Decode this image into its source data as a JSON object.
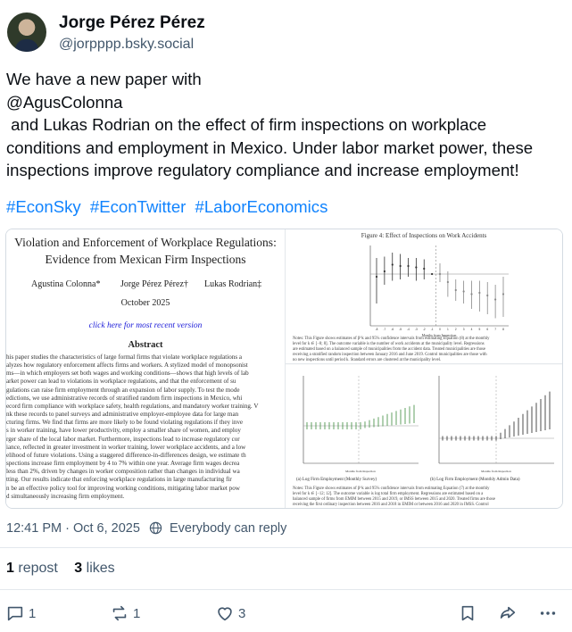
{
  "author": {
    "name": "Jorge Pérez Pérez",
    "handle": "@jorpppp.bsky.social"
  },
  "post": {
    "text": "We have a new paper with\n@AgusColonna\n and Lukas Rodrian on the effect of firm inspections on workplace conditions and employment in Mexico. Under labor market power, these inspections improve regulatory compliance and increase employment!",
    "hashtags": [
      "#EconSky",
      "#EconTwitter",
      "#LaborEconomics"
    ]
  },
  "embed": {
    "paper": {
      "title_line1": "Violation and Enforcement of Workplace Regulations:",
      "title_line2": "Evidence from Mexican Firm Inspections",
      "authors": [
        "Agustina Colonna*",
        "Jorge Pérez Pérez†",
        "Lukas Rodrian‡"
      ],
      "date": "October 2025",
      "link_text": "click here for most recent version",
      "abstract_heading": "Abstract",
      "abstract_lines": [
        "his paper studies the characteristics of large formal firms that violate workplace regulations a",
        "alyzes how regulatory enforcement affects firms and workers. A stylized model of monopsonist",
        "ms—in which employers set both wages and working conditions—shows that high levels of lab",
        "arket power can lead to violations in workplace regulations, and that the enforcement of su",
        "gulations can raise firm employment through an expansion of labor supply. To test the mode",
        "edictions, we use administrative records of stratified random firm inspections in Mexico, whi",
        "ecord firm compliance with workplace safety, health regulations, and mandatory worker training. V",
        "nk these records to panel surveys and administrative employer-employee data for large man",
        "cturing firms. We find that firms are more likely to be found violating regulations if they inve",
        "s in worker training, have lower productivity, employ a smaller share of women, and employ",
        "rger share of the local labor market. Furthermore, inspections lead to increase regulatory cor",
        "iance, reflected in greater investment in worker training, lower workplace accidents, and a low",
        "elihood of future violations. Using a staggered difference-in-differences design, we estimate th",
        "spections increase firm employment by 4 to 7% within one year. Average firm wages decrea",
        " less than 2%, driven by changes in worker composition rather than changes in individual wa",
        "tting. Our results indicate that enforcing workplace regulations in large manufacturing fir",
        "n be an effective policy tool for improving working conditions, mitigating labor market pow",
        "d simultaneously increasing firm employment."
      ]
    },
    "figures": {
      "top_title": "Figure 4: Effect of Inspections on Work Accidents",
      "top_note_lines": [
        "Notes: This Figure shows estimates of β^k and 95% confidence intervals from estimating Equation (8) at the monthly",
        "level for k ∈ [−8; 8]. The outcome variable is the number of work accidents at the municipality level. Regressions",
        "are estimated based on a balanced sample of municipalities from the accident data. Treated municipalities are those",
        "receiving a stratified random inspection between January 2016 and June 2019. Control municipalities are those with",
        "no new inspections until period k. Standard errors are clustered at the municipality level."
      ],
      "caption_a": "(a) Log Firm Employment (Monthly Survey)",
      "caption_b": "(b) Log Firm Employment (Monthly Admin Data)",
      "bottom_note_lines": [
        "Notes: This Figure shows estimates of β^k and 95% confidence intervals from estimating Equation (7) at the monthly",
        "level for k ∈ [−12; 12]. The outcome variable is log total firm employment. Regressions are estimated based on a",
        "balanced sample of firms from EMIM between 2015 and 2019, or IMSS between 2015 and 2020. Treated firms are those",
        "receiving the first ordinary inspection between 2016 and 2018 in EMIM or between 2016 and 2020 in IMSS. Control"
      ],
      "months_label": "Months from Inspection",
      "top_chart": {
        "x_ticks": [
          "-8",
          "-7",
          "-6",
          "-5",
          "-4",
          "-3",
          "-2",
          "-1",
          "0",
          "1",
          "2",
          "3",
          "4",
          "5",
          "6",
          "7",
          "8"
        ],
        "points": [
          {
            "k": -8,
            "est": -0.02,
            "lo": -0.22,
            "hi": 0.12
          },
          {
            "k": -7,
            "est": 0.02,
            "lo": -0.08,
            "hi": 0.13
          },
          {
            "k": -6,
            "est": 0.07,
            "lo": -0.05,
            "hi": 0.16
          },
          {
            "k": -5,
            "est": 0.06,
            "lo": -0.04,
            "hi": 0.15
          },
          {
            "k": -4,
            "est": 0.06,
            "lo": -0.02,
            "hi": 0.12
          },
          {
            "k": -3,
            "est": 0.05,
            "lo": -0.05,
            "hi": 0.12
          },
          {
            "k": -2,
            "est": 0.04,
            "lo": -0.04,
            "hi": 0.11
          },
          {
            "k": -1,
            "est": 0.0,
            "lo": 0.0,
            "hi": 0.0
          },
          {
            "k": 0,
            "est": 0.0,
            "lo": -0.06,
            "hi": 0.08
          },
          {
            "k": 1,
            "est": -0.06,
            "lo": -0.17,
            "hi": 0.02
          },
          {
            "k": 2,
            "est": -0.12,
            "lo": -0.2,
            "hi": -0.04
          },
          {
            "k": 3,
            "est": -0.13,
            "lo": -0.22,
            "hi": -0.05
          },
          {
            "k": 4,
            "est": -0.15,
            "lo": -0.26,
            "hi": -0.05
          },
          {
            "k": 5,
            "est": -0.14,
            "lo": -0.28,
            "hi": -0.05
          },
          {
            "k": 6,
            "est": -0.16,
            "lo": -0.3,
            "hi": -0.06
          },
          {
            "k": 7,
            "est": -0.19,
            "lo": -0.33,
            "hi": -0.08
          },
          {
            "k": 8,
            "est": -0.15,
            "lo": -0.32,
            "hi": -0.02
          }
        ]
      }
    }
  },
  "meta": {
    "timestamp": "12:41 PM · Oct 6, 2025",
    "reply_setting": "Everybody can reply"
  },
  "stats": {
    "reposts_count": "1",
    "reposts_label": "repost",
    "likes_count": "3",
    "likes_label": "likes"
  },
  "actions": {
    "reply_count": "1",
    "repost_count": "1",
    "like_count": "3"
  },
  "colors": {
    "link": "#1083fe",
    "muted": "#42576c",
    "text": "#0b0f14"
  }
}
